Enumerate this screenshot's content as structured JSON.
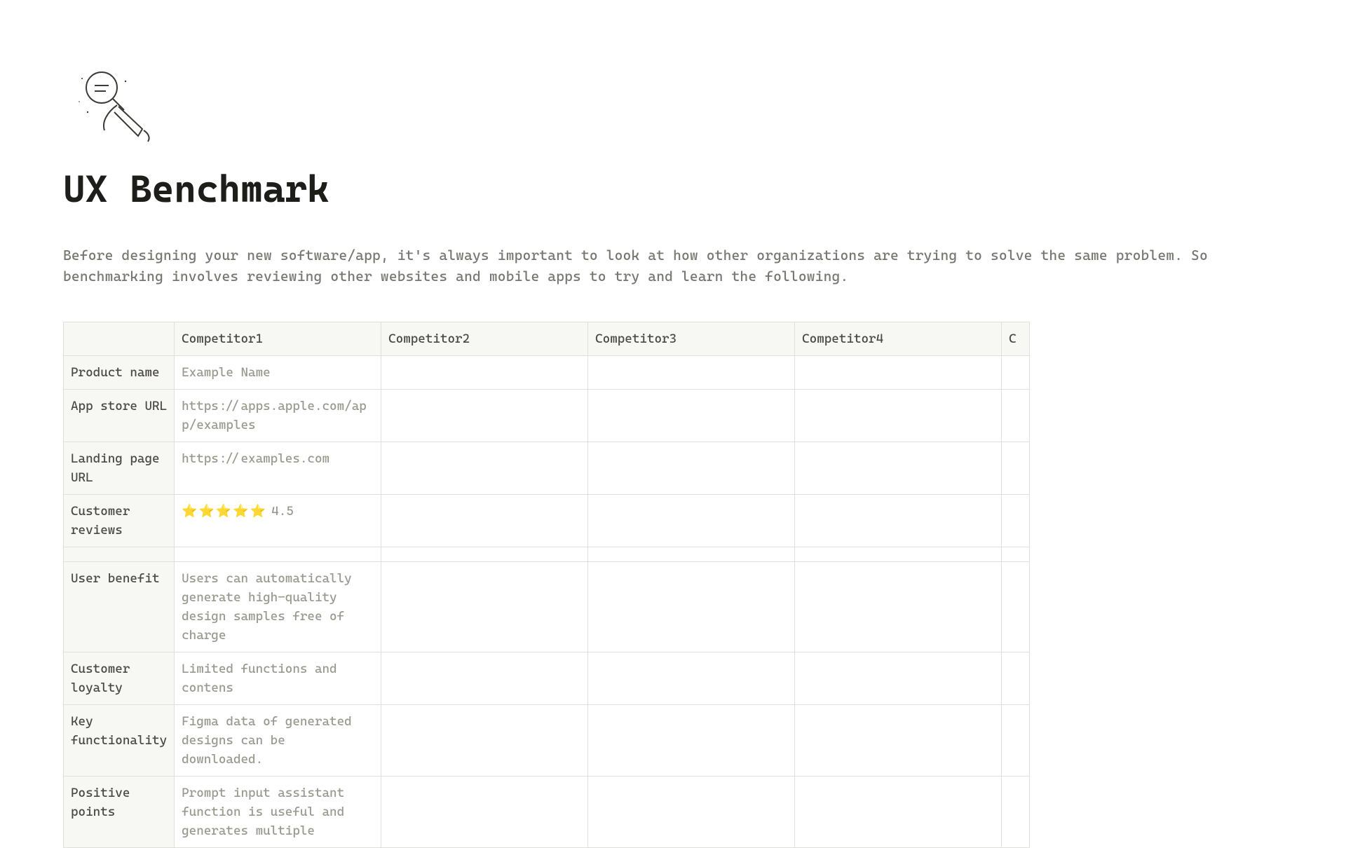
{
  "page": {
    "title": "UX Benchmark",
    "intro": "Before designing your new software/app, it's always important to look at how other organizations are trying to solve the same problem. So benchmarking involves reviewing other websites and mobile apps to try and learn the following."
  },
  "table": {
    "columns": [
      "",
      "Competitor1",
      "Competitor2",
      "Competitor3",
      "Competitor4",
      "C"
    ],
    "rows": [
      {
        "label": "Product name",
        "cells": [
          "Example Name",
          "",
          "",
          "",
          ""
        ]
      },
      {
        "label": "App store URL",
        "cells": [
          "https://apps.apple.com/app/examples",
          "",
          "",
          "",
          ""
        ]
      },
      {
        "label": "Landing page URL",
        "cells": [
          "https://examples.com",
          "",
          "",
          "",
          ""
        ]
      },
      {
        "label": "Customer reviews",
        "cells": [
          "★★★★★ 4.5",
          "",
          "",
          "",
          ""
        ],
        "stars": "⭐⭐⭐⭐⭐",
        "rating": "4.5"
      },
      {
        "label": "",
        "cells": [
          "",
          "",
          "",
          "",
          ""
        ]
      },
      {
        "label": "User benefit",
        "cells": [
          "Users can automatically generate high-quality design samples free of charge",
          "",
          "",
          "",
          ""
        ]
      },
      {
        "label": "Customer loyalty",
        "cells": [
          "Limited functions and contens",
          "",
          "",
          "",
          ""
        ]
      },
      {
        "label": "Key functionality",
        "cells": [
          "Figma data of generated designs can be downloaded.",
          "",
          "",
          "",
          ""
        ]
      },
      {
        "label": "Positive points",
        "cells": [
          "Prompt input assistant function is useful and generates multiple",
          "",
          "",
          "",
          ""
        ]
      }
    ]
  }
}
